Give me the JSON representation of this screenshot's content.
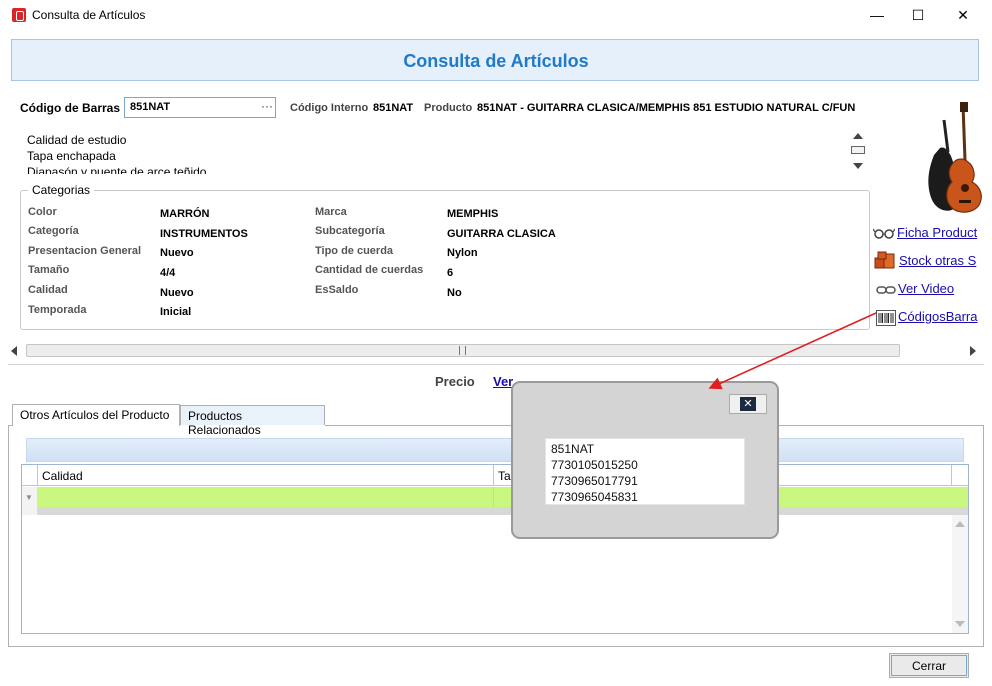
{
  "window": {
    "title": "Consulta de Artículos",
    "controls": {
      "minimize": "—",
      "maximize": "☐",
      "close": "✕"
    }
  },
  "header": {
    "title": "Consulta de Artículos"
  },
  "barcode": {
    "label": "Código de Barras",
    "value": "851NAT",
    "browse": "···",
    "internal_label": "Código Interno",
    "internal_value": "851NAT",
    "product_label": "Producto",
    "product_value": "851NAT - GUITARRA CLASICA/MEMPHIS 851 ESTUDIO NATURAL C/FUN"
  },
  "description": [
    "Calidad de estudio",
    "Tapa enchapada",
    "Diapasón y puente de arce teñido"
  ],
  "categories": {
    "legend": "Categorias",
    "left": [
      {
        "label": "Color",
        "value": "MARRÓN"
      },
      {
        "label": "Categoría",
        "value": "INSTRUMENTOS"
      },
      {
        "label": "Presentacion General",
        "value": "Nuevo"
      },
      {
        "label": "Tamaño",
        "value": "4/4"
      },
      {
        "label": "Calidad",
        "value": "Nuevo"
      },
      {
        "label": "Temporada",
        "value": "Inicial"
      }
    ],
    "right": [
      {
        "label": "Marca",
        "value": "MEMPHIS"
      },
      {
        "label": "Subcategoría",
        "value": "GUITARRA CLASICA"
      },
      {
        "label": "Tipo de cuerda",
        "value": "Nylon"
      },
      {
        "label": "Cantidad de cuerdas",
        "value": "6"
      },
      {
        "label": "EsSaldo",
        "value": "No"
      }
    ]
  },
  "side_links": [
    {
      "label": " Ficha Product",
      "icon": "glasses-icon"
    },
    {
      "label": " Stock otras S",
      "icon": "boxes-icon"
    },
    {
      "label": "Ver Video",
      "icon": "link-icon"
    },
    {
      "label": "CódigosBarra",
      "icon": "barcode-icon"
    }
  ],
  "precio": {
    "label": "Precio",
    "link": "Ver"
  },
  "tabs": [
    {
      "label": "Otros Artículos del Producto",
      "active": true
    },
    {
      "label": "Productos Relacionados",
      "active": false
    }
  ],
  "grid": {
    "columns": [
      "Calidad",
      "Ta"
    ]
  },
  "buttons": {
    "close": "Cerrar"
  },
  "popup": {
    "close": "✕",
    "codes": [
      "851NAT",
      "7730105015250",
      "7730965017791",
      "7730965045831"
    ]
  },
  "colors": {
    "header_text": "#1f7ac9",
    "link": "#1a0dab",
    "filter_row": "#c9f77f",
    "annotation_arrow": "#e02020"
  }
}
